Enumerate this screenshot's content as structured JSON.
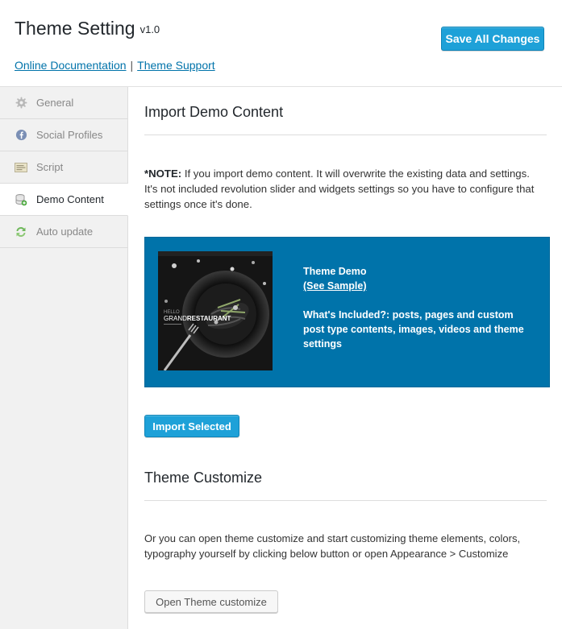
{
  "header": {
    "title": "Theme Setting",
    "version": "v1.0",
    "doc_link": "Online Documentation",
    "separator": "|",
    "support_link": "Theme Support",
    "save_label": "Save All Changes"
  },
  "sidebar": {
    "items": [
      {
        "label": "General",
        "icon": "gear-icon",
        "active": false
      },
      {
        "label": "Social Profiles",
        "icon": "facebook-icon",
        "active": false
      },
      {
        "label": "Script",
        "icon": "script-icon",
        "active": false
      },
      {
        "label": "Demo Content",
        "icon": "database-icon",
        "active": true
      },
      {
        "label": "Auto update",
        "icon": "refresh-icon",
        "active": false
      }
    ]
  },
  "main": {
    "import_title": "Import Demo Content",
    "note_label": "*NOTE:",
    "note_text": " If you import demo content. It will overwrite the existing data and settings. It's not included revolution slider and widgets settings so you have to configure that settings once it's done.",
    "demo": {
      "title": "Theme Demo",
      "sample_link": "(See Sample)",
      "included": "What's Included?: posts, pages and custom post type contents, images, videos and theme settings",
      "thumb_brand": "GRAND",
      "thumb_brand_bold": "RESTAURANT",
      "thumb_sub": "HELLO"
    },
    "import_button": "Import Selected",
    "customize_title": "Theme Customize",
    "customize_text": "Or you can open theme customize and start customizing theme elements, colors, typography yourself by clicking below button or open Appearance > Customize",
    "customize_button": "Open Theme customize"
  },
  "colors": {
    "accent": "#1ea1d8",
    "demo_box": "#0073aa",
    "link": "#0073aa"
  }
}
